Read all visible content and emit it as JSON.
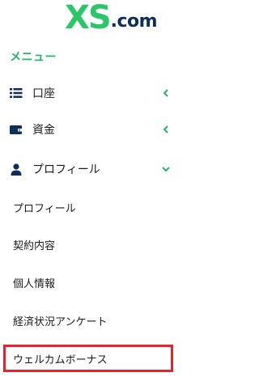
{
  "brand": {
    "logo_main": "XS",
    "logo_suffix": ".com",
    "color_green": "#2ac768",
    "color_navy": "#0f2e5c"
  },
  "menu": {
    "section_title": "メニュー",
    "items": [
      {
        "label": "口座",
        "icon": "list-icon",
        "chevron": "chevron-left-icon"
      },
      {
        "label": "資金",
        "icon": "wallet-icon",
        "chevron": "chevron-left-icon"
      },
      {
        "label": "プロフィール",
        "icon": "user-icon",
        "chevron": "chevron-down-icon"
      }
    ],
    "profile_subitems": [
      {
        "label": "プロフィール"
      },
      {
        "label": "契約内容"
      },
      {
        "label": "個人情報"
      },
      {
        "label": "経済状況アンケート"
      },
      {
        "label": "ウェルカムボーナス"
      }
    ]
  },
  "colors": {
    "accent": "#23b565",
    "highlight": "#e0252c"
  }
}
